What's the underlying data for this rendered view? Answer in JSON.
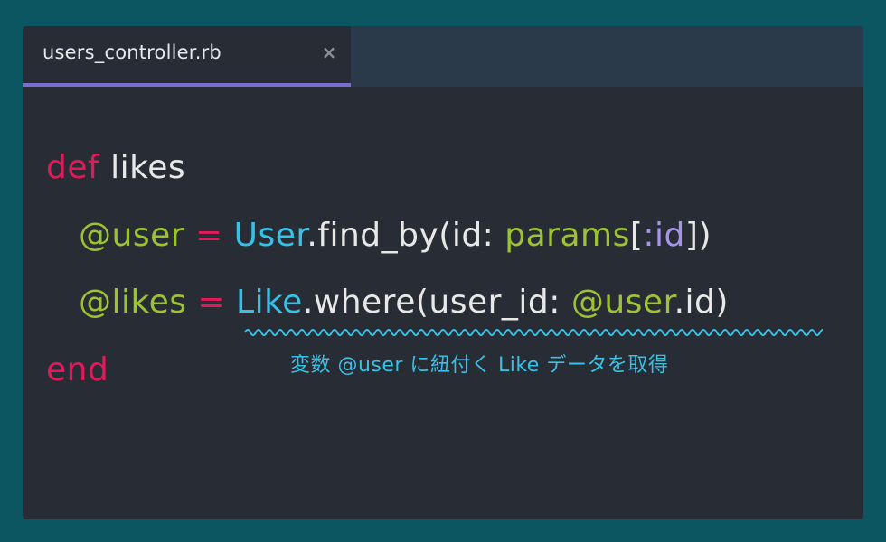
{
  "tab": {
    "title": "users_controller.rb",
    "close_glyph": "×"
  },
  "code": {
    "line1": {
      "kw": "def",
      "name": " likes"
    },
    "line2": {
      "ivar": "@user",
      "op": " = ",
      "const": "User",
      "call": ".find_by(id: ",
      "params": "params",
      "open": "[",
      "sym": ":id",
      "close": "])"
    },
    "line3": {
      "ivar": "@likes",
      "op": " = ",
      "const": "Like",
      "call": ".where(user_id: ",
      "ivar2": "@user",
      "tail": ".id)"
    },
    "line4": {
      "kw": "end"
    }
  },
  "annotation": {
    "text": "変数 @user に紐付く Like データを取得"
  },
  "colors": {
    "keyword": "#e3195b",
    "instance_var": "#9dc234",
    "constant": "#38c1e6",
    "symbol": "#a694e8",
    "tab_underline": "#7b6ccf",
    "background": "#0b5660",
    "editor_bg": "#282c34"
  }
}
